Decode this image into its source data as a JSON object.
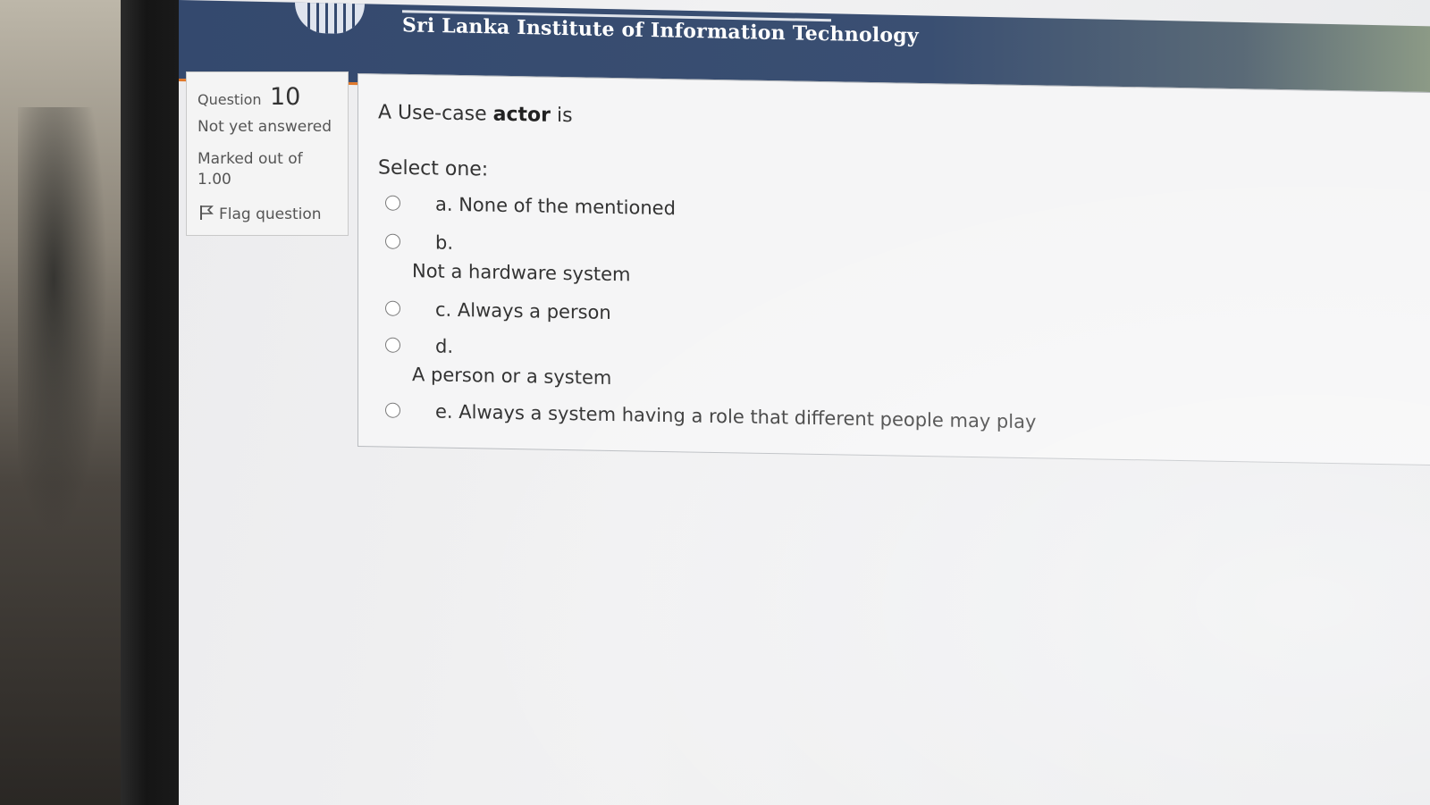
{
  "header": {
    "institution": "Sri Lanka Institute of Information Technology"
  },
  "info": {
    "question_label": "Question",
    "question_number": "10",
    "state": "Not yet answered",
    "marked_out_of": "Marked out of",
    "marks": "1.00",
    "flag_label": "Flag question"
  },
  "question": {
    "text_before": "A Use-case ",
    "text_bold": "actor",
    "text_after": " is",
    "prompt": "Select one:",
    "options": [
      {
        "label": "a. None of the mentioned",
        "text": ""
      },
      {
        "label": "b.",
        "text": "Not a hardware system"
      },
      {
        "label": "c. Always a person",
        "text": ""
      },
      {
        "label": "d.",
        "text": "A person or a system"
      },
      {
        "label": "e. Always a system having a role that different people may play",
        "text": ""
      }
    ]
  },
  "colors": {
    "header": "#34496e",
    "accent": "#e0782a"
  }
}
